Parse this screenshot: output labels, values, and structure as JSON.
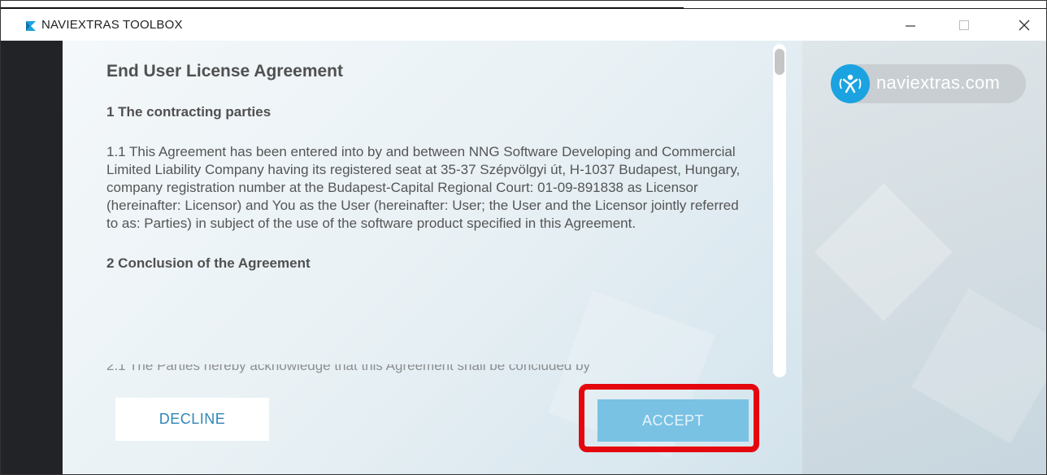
{
  "window": {
    "title": "NAVIEXTRAS TOOLBOX",
    "controls": {
      "minimize": "–",
      "maximize": "□",
      "close": "✕"
    }
  },
  "brand": {
    "logo_text": "naviextras.com",
    "accent": "#1aa3e0"
  },
  "eula": {
    "title": "End User License Agreement",
    "sections": [
      {
        "heading": "1 The contracting parties",
        "paragraph": "1.1 This Agreement has been entered into by and between NNG Software Developing and Commercial Limited Liability Company having its registered seat at 35-37 Szépvölgyi út, H-1037 Budapest, Hungary, company registration number at the Budapest-Capital Regional Court: 01-09-891838 as Licensor (hereinafter: Licensor) and You as the User (hereinafter: User; the User and the Licensor jointly referred to as: Parties) in subject of the use of the software product specified in this Agreement."
      },
      {
        "heading": "2 Conclusion of the Agreement",
        "paragraph": "2.1 The Parties hereby acknowledge that this Agreement shall be concluded by"
      }
    ]
  },
  "actions": {
    "decline_label": "DECLINE",
    "accept_label": "ACCEPT",
    "highlight_color": "#e4080e"
  }
}
